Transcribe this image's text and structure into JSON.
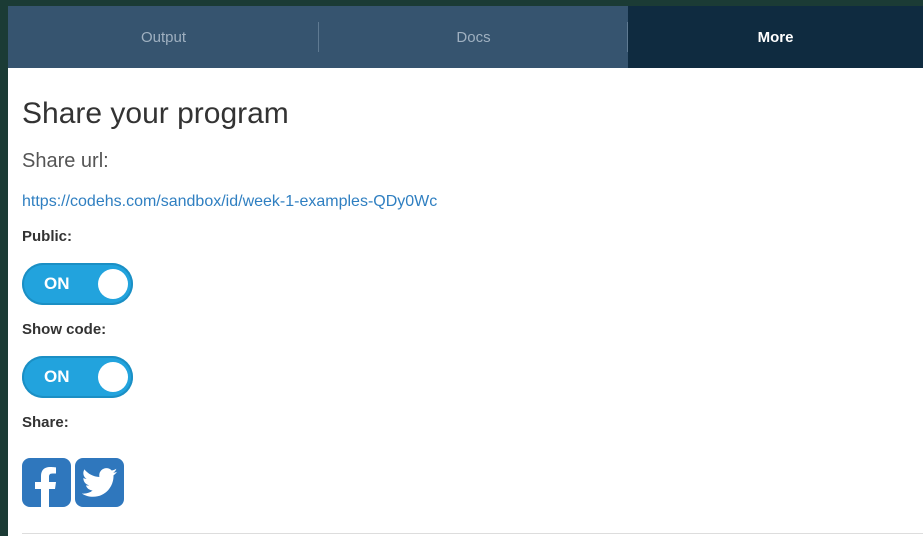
{
  "tabs": [
    {
      "label": "Output"
    },
    {
      "label": "Docs"
    },
    {
      "label": "More"
    }
  ],
  "active_tab": "More",
  "share_panel": {
    "title": "Share your program",
    "share_url_label": "Share url:",
    "share_url": "https://codehs.com/sandbox/id/week-1-examples-QDy0Wc",
    "public_label": "Public:",
    "public_toggle": "ON",
    "show_code_label": "Show code:",
    "show_code_toggle": "ON",
    "share_label": "Share:",
    "social": [
      {
        "icon": "facebook-icon"
      },
      {
        "icon": "twitter-icon"
      }
    ]
  },
  "colors": {
    "tab_bar": "#36546f",
    "active_tab": "#0f2b40",
    "toggle_on": "#22a3dd",
    "link": "#2f7fc1",
    "social": "#2f77bd"
  }
}
